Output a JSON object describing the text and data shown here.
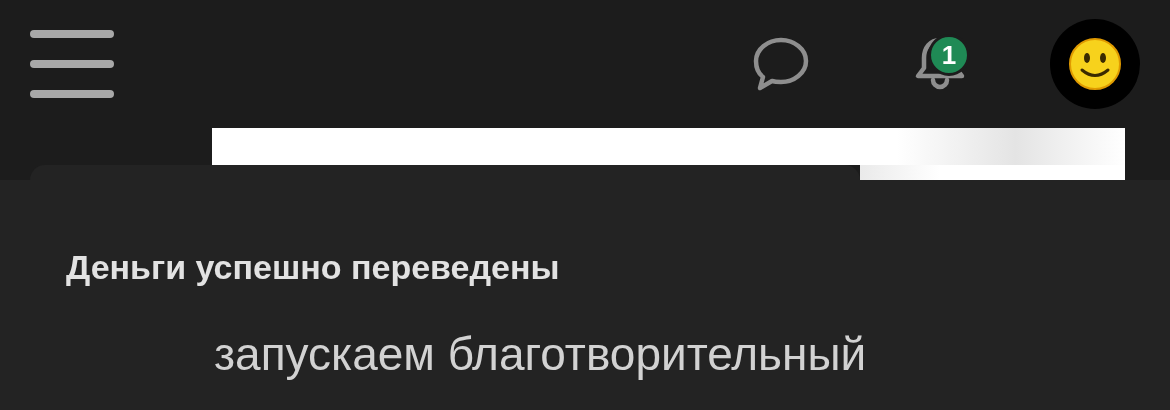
{
  "header": {
    "notification_badge": "1"
  },
  "toast": {
    "title": "Деньги успешно переведены"
  },
  "content": {
    "text": "запускаем благотворительный"
  }
}
